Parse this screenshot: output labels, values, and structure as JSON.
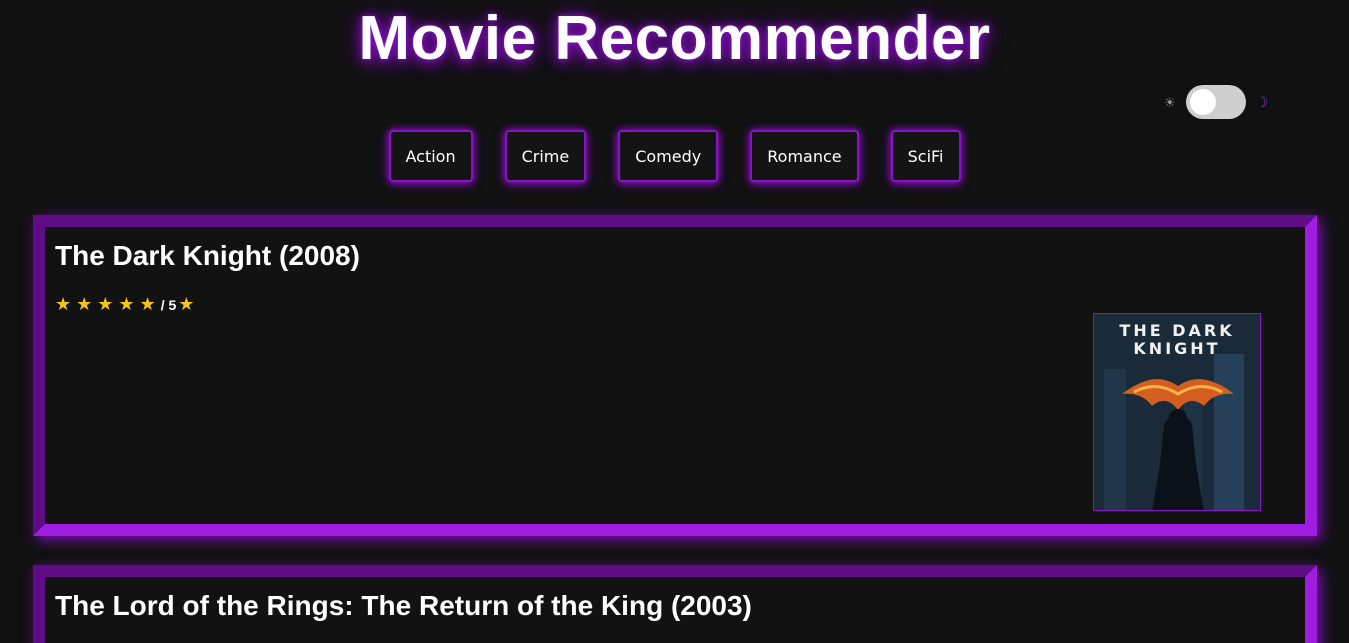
{
  "header": {
    "title": "Movie Recommender"
  },
  "theme_toggle": {
    "sun_icon": "☀",
    "moon_icon": "☽"
  },
  "genres": [
    "Action",
    "Crime",
    "Comedy",
    "Romance",
    "SciFi"
  ],
  "movies": [
    {
      "title": "The Dark Knight (2008)",
      "stars": "★ ★ ★ ★ ★",
      "rating_scale": "/ 5",
      "trailing_star": "★",
      "poster_text": "THE DARK\nKNIGHT"
    },
    {
      "title": "The Lord of the Rings: The Return of the King (2003)"
    }
  ],
  "colors": {
    "background": "#111111",
    "accent_purple": "#a01ce0",
    "star": "#f5c518"
  }
}
